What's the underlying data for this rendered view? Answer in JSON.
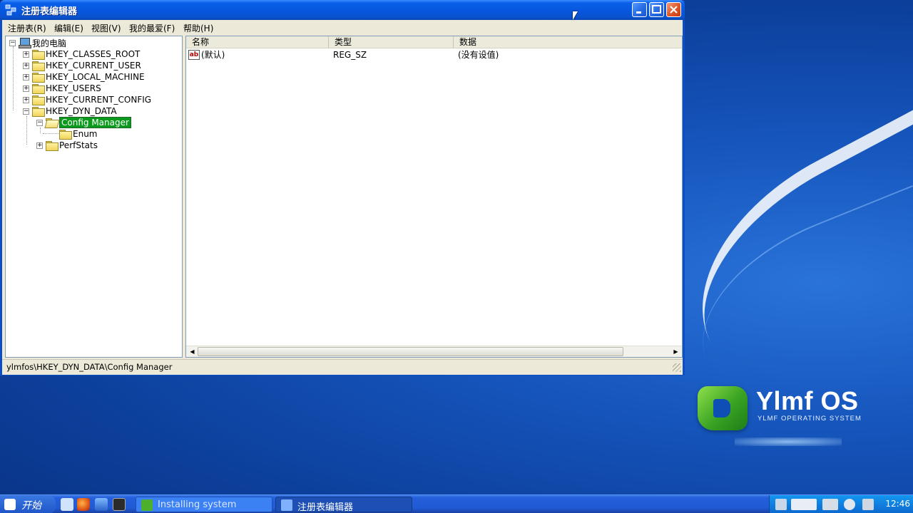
{
  "desktop": {
    "logo_title": "Ylmf OS",
    "logo_subtitle": "YLMF OPERATING SYSTEM"
  },
  "window": {
    "title": "注册表编辑器",
    "menu": [
      "注册表(R)",
      "编辑(E)",
      "视图(V)",
      "我的最爱(F)",
      "帮助(H)"
    ],
    "tree": {
      "root": "我的电脑",
      "hives": [
        "HKEY_CLASSES_ROOT",
        "HKEY_CURRENT_USER",
        "HKEY_LOCAL_MACHINE",
        "HKEY_USERS",
        "HKEY_CURRENT_CONFIG",
        "HKEY_DYN_DATA"
      ],
      "dyn_children": [
        "Config Manager",
        "PerfStats"
      ],
      "config_children": [
        "Enum"
      ],
      "selected": "Config Manager"
    },
    "list": {
      "columns": [
        "名称",
        "类型",
        "数据"
      ],
      "rows": [
        {
          "name": "(默认)",
          "type": "REG_SZ",
          "data": "(没有设值)"
        }
      ]
    },
    "status": "ylmfos\\HKEY_DYN_DATA\\Config Manager"
  },
  "taskbar": {
    "start_label": "开始",
    "tasks": [
      "Installing system",
      "注册表编辑器"
    ],
    "clock": "12:46"
  },
  "colors": {
    "selection": "#0a9a1c",
    "titlebar": "#0756dd",
    "desktop": "#1656bd"
  }
}
